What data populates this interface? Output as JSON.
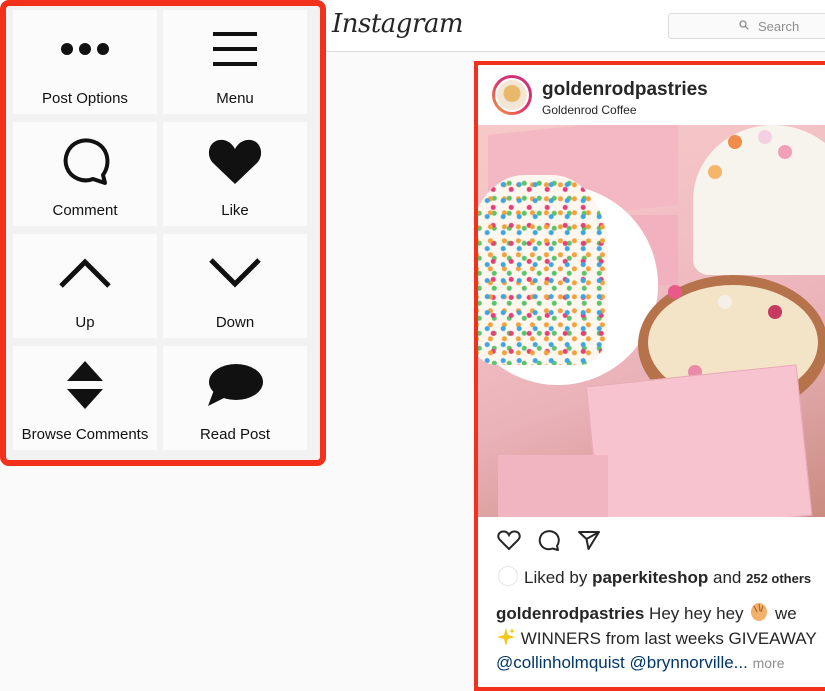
{
  "header": {
    "logo": "Instagram",
    "search_placeholder": "Search"
  },
  "controls": [
    {
      "label": "Post Options",
      "icon": "more-dots-icon"
    },
    {
      "label": "Menu",
      "icon": "hamburger-icon"
    },
    {
      "label": "Comment",
      "icon": "comment-bubble-icon"
    },
    {
      "label": "Like",
      "icon": "heart-icon"
    },
    {
      "label": "Up",
      "icon": "chevron-up-icon"
    },
    {
      "label": "Down",
      "icon": "chevron-down-icon"
    },
    {
      "label": "Browse Comments",
      "icon": "up-down-arrows-icon"
    },
    {
      "label": "Read Post",
      "icon": "speech-bubble-icon"
    }
  ],
  "post": {
    "username": "goldenrodpastries",
    "location": "Goldenrod Coffee",
    "liked_prefix": "Liked by",
    "liked_user": "paperkiteshop",
    "liked_and": "and",
    "liked_others": "252 others",
    "caption_user": "goldenrodpastries",
    "caption_line1": "Hey hey hey",
    "caption_line1_tail": "we",
    "caption_line2": "WINNERS from last weeks GIVEAWAY",
    "mention1": "@collinholmquist",
    "mention2": "@brynnorville...",
    "more_label": "more"
  },
  "colors": {
    "highlight": "#f2301b",
    "text": "#262626",
    "mention": "#00376b"
  }
}
